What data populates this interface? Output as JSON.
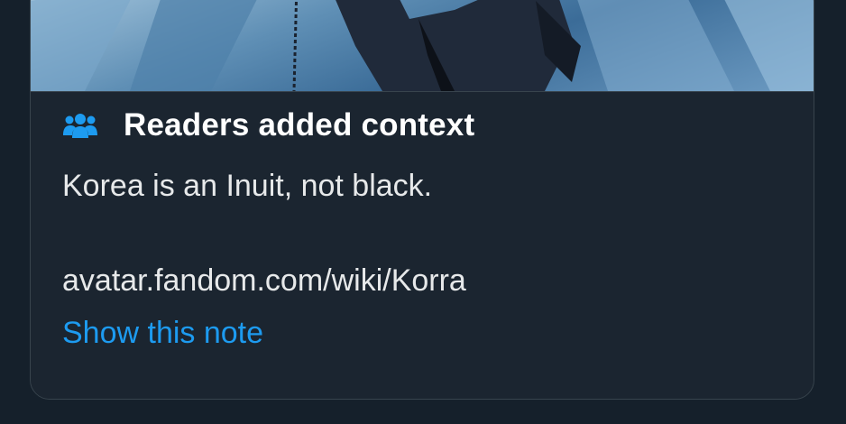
{
  "note": {
    "header_icon": "people-icon",
    "title": "Readers added context",
    "body": "Korea is an Inuit, not black.",
    "link_text": "avatar.fandom.com/wiki/Korra",
    "show_note_label": "Show this note"
  },
  "colors": {
    "background": "#15202b",
    "card_background": "#1b2530",
    "border": "#38444d",
    "text_primary": "#e7e9ea",
    "accent": "#1d9bf0"
  }
}
